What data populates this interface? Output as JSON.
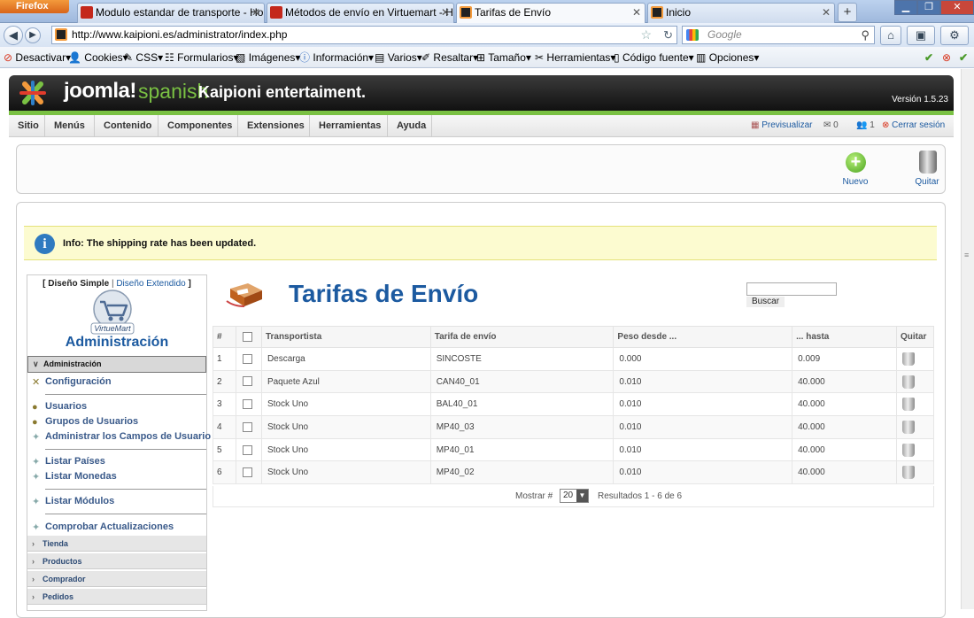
{
  "browser": {
    "menu_button": "Firefox",
    "tabs": [
      {
        "label": "Modulo estandar de transporte - Hos...",
        "active": false
      },
      {
        "label": "Métodos de envío en Virtuemart - Ho...",
        "active": false
      },
      {
        "label": "Tarifas de Envío",
        "active": true
      },
      {
        "label": "Inicio",
        "active": false
      }
    ],
    "new_tab": "+",
    "url": "http://www.kaipioni.es/administrator/index.php",
    "search_placeholder": "Google"
  },
  "devtoolbar": {
    "items": [
      "Desactivar▾",
      "Cookies▾",
      "CSS▾",
      "Formularios▾",
      "Imágenes▾",
      "Información▾",
      "Varios▾",
      "Resaltar▾",
      "Tamaño▾",
      "Herramientas▾",
      "Código fuente▾",
      "Opciones▾"
    ]
  },
  "header": {
    "logo_word": "joomla!",
    "logo_lang": "spanish",
    "site_name": "Kaipioni entertaiment.",
    "version": "Versión 1.5.23"
  },
  "menu": {
    "items": [
      "Sitio",
      "Menús",
      "Contenido",
      "Componentes",
      "Extensiones",
      "Herramientas",
      "Ayuda"
    ],
    "preview": "Previsualizar",
    "messages_count": "0",
    "users_count": "1",
    "logout": "Cerrar sesión"
  },
  "toolbar": {
    "new_label": "Nuevo",
    "delete_label": "Quitar"
  },
  "message": "Info: The shipping rate has been updated.",
  "sidebar": {
    "design_simple": "[ Diseño Simple",
    "design_separator": "|",
    "design_extended": "Diseño Extendido",
    "design_close": "]",
    "logo_text": "VirtueMart",
    "title": "Administración",
    "section_active": "Administración",
    "links": [
      "Configuración",
      "Usuarios",
      "Grupos de Usuarios",
      "Administrar los Campos de Usuario",
      "Listar Países",
      "Listar Monedas",
      "Listar Módulos",
      "Comprobar Actualizaciones"
    ],
    "sections": [
      "Tienda",
      "Productos",
      "Comprador",
      "Pedidos"
    ]
  },
  "page": {
    "title": "Tarifas de Envío",
    "search_button": "Buscar",
    "search_value": ""
  },
  "table": {
    "headers": [
      "#",
      "",
      "Transportista",
      "Tarifa de envío",
      "Peso desde ...",
      "... hasta",
      "Quitar"
    ],
    "rows": [
      {
        "num": "1",
        "carrier": "Descarga",
        "rate": "SINCOSTE",
        "from": "0.000",
        "to": "0.009"
      },
      {
        "num": "2",
        "carrier": "Paquete Azul",
        "rate": "CAN40_01",
        "from": "0.010",
        "to": "40.000"
      },
      {
        "num": "3",
        "carrier": "Stock Uno",
        "rate": "BAL40_01",
        "from": "0.010",
        "to": "40.000"
      },
      {
        "num": "4",
        "carrier": "Stock Uno",
        "rate": "MP40_03",
        "from": "0.010",
        "to": "40.000"
      },
      {
        "num": "5",
        "carrier": "Stock Uno",
        "rate": "MP40_01",
        "from": "0.010",
        "to": "40.000"
      },
      {
        "num": "6",
        "carrier": "Stock Uno",
        "rate": "MP40_02",
        "from": "0.010",
        "to": "40.000"
      }
    ]
  },
  "pagination": {
    "show_label": "Mostrar #",
    "page_size": "20",
    "results": "Resultados 1 - 6 de 6"
  },
  "colors": {
    "accent_green": "#7ac143",
    "title_blue": "#1c5aa0",
    "info_bg": "#fcfbd0"
  }
}
